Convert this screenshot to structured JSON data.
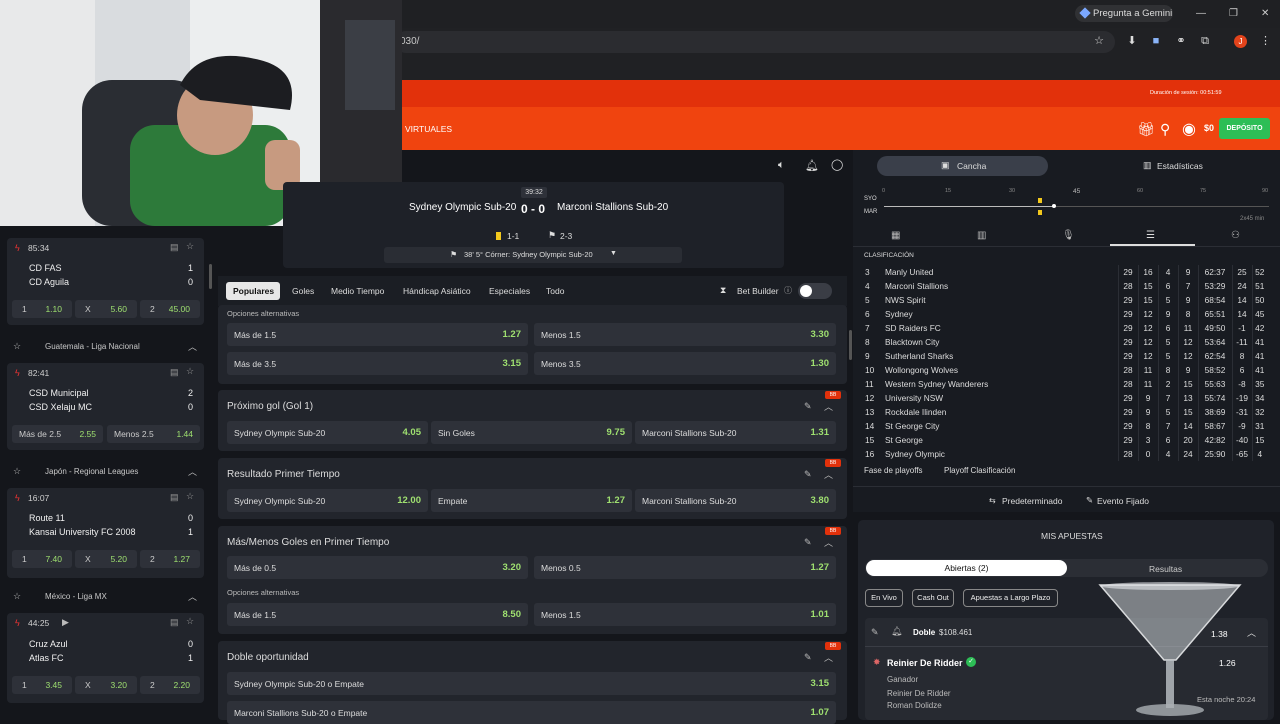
{
  "browser": {
    "gemini": "Pregunta a Gemini",
    "url_fragment": "030/",
    "profile_initial": "J"
  },
  "header": {
    "session_label": "Duración de sesión: 00:51:59",
    "virtuales": "VIRTUALES",
    "balance": "$0",
    "deposit": "DEPÓSITO"
  },
  "match": {
    "home": "Sydney Olympic Sub-20",
    "away": "Marconi Stallions Sub-20",
    "score": "0 - 0",
    "clock": "39:32",
    "cards": "1-1",
    "corners": "2-3",
    "event": "38'  5° Córner: Sydney Olympic Sub-20"
  },
  "market_tabs": [
    "Populares",
    "Goles",
    "Medio Tiempo",
    "Hándicap Asiático",
    "Especiales",
    "Todo"
  ],
  "bet_builder": "Bet Builder",
  "markets": {
    "alt_label": "Opciones alternativas",
    "top_rows": [
      {
        "l": "Más de 1.5",
        "lv": "1.27",
        "r": "Menos 1.5",
        "rv": "3.30"
      },
      {
        "l": "Más de 3.5",
        "lv": "3.15",
        "r": "Menos 3.5",
        "rv": "1.30"
      }
    ],
    "next_goal": {
      "title": "Próximo gol (Gol 1)",
      "a": "Sydney Olympic Sub-20",
      "av": "4.05",
      "b": "Sin Goles",
      "bv": "9.75",
      "c": "Marconi Stallions Sub-20",
      "cv": "1.31"
    },
    "first_half": {
      "title": "Resultado Primer Tiempo",
      "a": "Sydney Olympic Sub-20",
      "av": "12.00",
      "b": "Empate",
      "bv": "1.27",
      "c": "Marconi Stallions Sub-20",
      "cv": "3.80"
    },
    "ou_first": {
      "title": "Más/Menos Goles en Primer Tiempo",
      "l": "Más de 0.5",
      "lv": "3.20",
      "r": "Menos 0.5",
      "rv": "1.27",
      "l2": "Más de 1.5",
      "lv2": "8.50",
      "r2": "Menos 1.5",
      "rv2": "1.01"
    },
    "double": {
      "title": "Doble oportunidad",
      "a": "Sydney Olympic Sub-20 o Empate",
      "av": "3.15",
      "b": "Marconi Stallions Sub-20 o Empate",
      "bv": "1.07"
    },
    "badge": "BB"
  },
  "sidebar": {
    "m1": {
      "time": "85:34",
      "home": "CD FAS",
      "hs": "1",
      "away": "CD Aguila",
      "as": "0",
      "o1": "1.10",
      "ox": "5.60",
      "o2": "45.00"
    },
    "l2": "Guatemala - Liga Nacional",
    "m2": {
      "time": "82:41",
      "home": "CSD Municipal",
      "hs": "2",
      "away": "CSD Xelaju MC",
      "as": "0",
      "ol": "Más de 2.5",
      "olv": "2.55",
      "or": "Menos 2.5",
      "orv": "1.44"
    },
    "l3": "Japón - Regional Leagues",
    "m3": {
      "time": "16:07",
      "home": "Route 11",
      "hs": "0",
      "away": "Kansai University FC 2008",
      "as": "1",
      "o1": "7.40",
      "ox": "5.20",
      "o2": "1.27"
    },
    "l4": "México - Liga MX",
    "m4": {
      "time": "44:25",
      "home": "Cruz Azul",
      "hs": "0",
      "away": "Atlas FC",
      "as": "1",
      "o1": "3.45",
      "ox": "3.20",
      "o2": "2.20"
    },
    "k1": "1",
    "kx": "X",
    "k2": "2"
  },
  "right": {
    "cancha": "Cancha",
    "stats": "Estadísticas",
    "tl_ticks": [
      "0",
      "15",
      "30",
      "45",
      "60",
      "75",
      "90"
    ],
    "tl_home": "SYO",
    "tl_away": "MAR",
    "tl_right": "2x45 min",
    "class_label": "CLASIFICACIÓN",
    "standings": [
      [
        "3",
        "Manly United",
        "29",
        "16",
        "4",
        "9",
        "62:37",
        "25",
        "52"
      ],
      [
        "4",
        "Marconi Stallions",
        "28",
        "15",
        "6",
        "7",
        "53:29",
        "24",
        "51"
      ],
      [
        "5",
        "NWS Spirit",
        "29",
        "15",
        "5",
        "9",
        "68:54",
        "14",
        "50"
      ],
      [
        "6",
        "Sydney",
        "29",
        "12",
        "9",
        "8",
        "65:51",
        "14",
        "45"
      ],
      [
        "7",
        "SD Raiders FC",
        "29",
        "12",
        "6",
        "11",
        "49:50",
        "-1",
        "42"
      ],
      [
        "8",
        "Blacktown City",
        "29",
        "12",
        "5",
        "12",
        "53:64",
        "-11",
        "41"
      ],
      [
        "9",
        "Sutherland Sharks",
        "29",
        "12",
        "5",
        "12",
        "62:54",
        "8",
        "41"
      ],
      [
        "10",
        "Wollongong Wolves",
        "28",
        "11",
        "8",
        "9",
        "58:52",
        "6",
        "41"
      ],
      [
        "11",
        "Western Sydney Wanderers",
        "28",
        "11",
        "2",
        "15",
        "55:63",
        "-8",
        "35"
      ],
      [
        "12",
        "University NSW",
        "29",
        "9",
        "7",
        "13",
        "55:74",
        "-19",
        "34"
      ],
      [
        "13",
        "Rockdale Ilinden",
        "29",
        "9",
        "5",
        "15",
        "38:69",
        "-31",
        "32"
      ],
      [
        "14",
        "St George City",
        "29",
        "8",
        "7",
        "14",
        "58:67",
        "-9",
        "31"
      ],
      [
        "15",
        "St George",
        "29",
        "3",
        "6",
        "20",
        "42:82",
        "-40",
        "15"
      ],
      [
        "16",
        "Sydney Olympic",
        "28",
        "0",
        "4",
        "24",
        "25:90",
        "-65",
        "4"
      ]
    ],
    "legend1": "Fase de playoffs",
    "legend2": "Playoff Clasificación",
    "predeterminado": "Predeterminado",
    "fijado": "Evento Fijado",
    "bets_title": "MIS APUESTAS",
    "open": "Abiertas (2)",
    "settled": "Resultas",
    "filters": [
      "En Vivo",
      "Cash Out",
      "Apuestas a Largo Plazo"
    ],
    "bet": {
      "type": "Doble",
      "amount": "$108.461",
      "odds": "1.38",
      "sel": "Reinier De Ridder",
      "sel_odds": "1.26",
      "market": "Ganador",
      "p1": "Reinier De Ridder",
      "p2": "Roman Dolidze",
      "time": "Esta noche 20:24"
    }
  }
}
